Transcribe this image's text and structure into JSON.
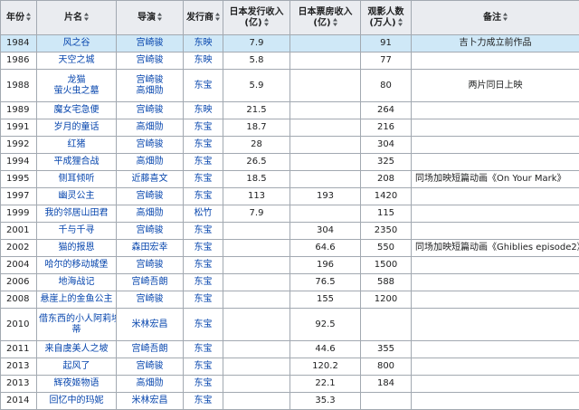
{
  "headers": [
    "年份",
    "片名",
    "导演",
    "发行商",
    "日本发行收入",
    "(亿)",
    "日本票房收入",
    "(亿)",
    "观影人数",
    "(万人)",
    "备注"
  ],
  "rows": [
    {
      "year": "1984",
      "title": [
        "风之谷"
      ],
      "director": [
        "宫崎骏"
      ],
      "distributor": "东映",
      "dist_income": "7.9",
      "box_office": "",
      "viewers": "91",
      "note": "吉卜力成立前作品",
      "highlight": true
    },
    {
      "year": "1986",
      "title": [
        "天空之城"
      ],
      "director": [
        "宫崎骏"
      ],
      "distributor": "东映",
      "dist_income": "5.8",
      "box_office": "",
      "viewers": "77",
      "note": ""
    },
    {
      "year": "1988",
      "title": [
        "龙猫",
        "萤火虫之墓"
      ],
      "director": [
        "宫崎骏",
        "高畑勋"
      ],
      "distributor": "东宝",
      "dist_income": "5.9",
      "box_office": "",
      "viewers": "80",
      "note": "两片同日上映"
    },
    {
      "year": "1989",
      "title": [
        "魔女宅急便"
      ],
      "director": [
        "宫崎骏"
      ],
      "distributor": "东映",
      "dist_income": "21.5",
      "box_office": "",
      "viewers": "264",
      "note": ""
    },
    {
      "year": "1991",
      "title": [
        "岁月的童话"
      ],
      "director": [
        "高畑勋"
      ],
      "distributor": "东宝",
      "dist_income": "18.7",
      "box_office": "",
      "viewers": "216",
      "note": ""
    },
    {
      "year": "1992",
      "title": [
        "红猪"
      ],
      "director": [
        "宫崎骏"
      ],
      "distributor": "东宝",
      "dist_income": "28",
      "box_office": "",
      "viewers": "304",
      "note": ""
    },
    {
      "year": "1994",
      "title": [
        "平成狸合战"
      ],
      "director": [
        "高畑勋"
      ],
      "distributor": "东宝",
      "dist_income": "26.5",
      "box_office": "",
      "viewers": "325",
      "note": ""
    },
    {
      "year": "1995",
      "title": [
        "侧耳倾听"
      ],
      "director": [
        "近藤喜文"
      ],
      "distributor": "东宝",
      "dist_income": "18.5",
      "box_office": "",
      "viewers": "208",
      "note": "同场加映短篇动画《On Your Mark》"
    },
    {
      "year": "1997",
      "title": [
        "幽灵公主"
      ],
      "director": [
        "宫崎骏"
      ],
      "distributor": "东宝",
      "dist_income": "113",
      "box_office": "193",
      "viewers": "1420",
      "note": ""
    },
    {
      "year": "1999",
      "title": [
        "我的邻居山田君"
      ],
      "director": [
        "高畑勋"
      ],
      "distributor": "松竹",
      "dist_income": "7.9",
      "box_office": "",
      "viewers": "115",
      "note": ""
    },
    {
      "year": "2001",
      "title": [
        "千与千寻"
      ],
      "director": [
        "宫崎骏"
      ],
      "distributor": "东宝",
      "dist_income": "",
      "box_office": "304",
      "viewers": "2350",
      "note": ""
    },
    {
      "year": "2002",
      "title": [
        "猫的报恩"
      ],
      "director": [
        "森田宏幸"
      ],
      "distributor": "东宝",
      "dist_income": "",
      "box_office": "64.6",
      "viewers": "550",
      "note": "同场加映短篇动画《Ghiblies episode2》"
    },
    {
      "year": "2004",
      "title": [
        "哈尔的移动城堡"
      ],
      "director": [
        "宫崎骏"
      ],
      "distributor": "东宝",
      "dist_income": "",
      "box_office": "196",
      "viewers": "1500",
      "note": ""
    },
    {
      "year": "2006",
      "title": [
        "地海战记"
      ],
      "director": [
        "宫崎吾朗"
      ],
      "distributor": "东宝",
      "dist_income": "",
      "box_office": "76.5",
      "viewers": "588",
      "note": ""
    },
    {
      "year": "2008",
      "title": [
        "悬崖上的金鱼公主"
      ],
      "director": [
        "宫崎骏"
      ],
      "distributor": "东宝",
      "dist_income": "",
      "box_office": "155",
      "viewers": "1200",
      "note": ""
    },
    {
      "year": "2010",
      "title": [
        "借东西的小人阿莉埃",
        "蒂"
      ],
      "director": [
        "米林宏昌"
      ],
      "distributor": "东宝",
      "dist_income": "",
      "box_office": "92.5",
      "viewers": "",
      "note": ""
    },
    {
      "year": "2011",
      "title": [
        "来自虞美人之坡"
      ],
      "director": [
        "宫崎吾朗"
      ],
      "distributor": "东宝",
      "dist_income": "",
      "box_office": "44.6",
      "viewers": "355",
      "note": ""
    },
    {
      "year": "2013",
      "title": [
        "起风了"
      ],
      "director": [
        "宫崎骏"
      ],
      "distributor": "东宝",
      "dist_income": "",
      "box_office": "120.2",
      "viewers": "800",
      "note": ""
    },
    {
      "year": "2013",
      "title": [
        "辉夜姬物语"
      ],
      "director": [
        "高畑勋"
      ],
      "distributor": "东宝",
      "dist_income": "",
      "box_office": "22.1",
      "viewers": "184",
      "note": ""
    },
    {
      "year": "2014",
      "title": [
        "回忆中的玛妮"
      ],
      "director": [
        "米林宏昌"
      ],
      "distributor": "东宝",
      "dist_income": "",
      "box_office": "35.3",
      "viewers": "",
      "note": ""
    }
  ]
}
